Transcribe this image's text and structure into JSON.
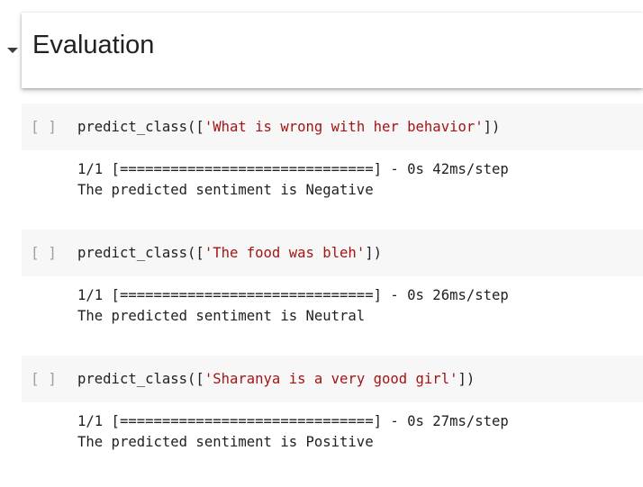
{
  "section": {
    "title": "Evaluation"
  },
  "cells": [
    {
      "run_label": "[ ]",
      "code_prefix": "predict_class([",
      "code_string": "'What is wrong with her behavior'",
      "code_suffix": "])",
      "progress_line": "1/1 [==============================] - 0s 42ms/step",
      "result_line": "The predicted sentiment is Negative"
    },
    {
      "run_label": "[ ]",
      "code_prefix": "predict_class([",
      "code_string": "'The food was bleh'",
      "code_suffix": "])",
      "progress_line": "1/1 [==============================] - 0s 26ms/step",
      "result_line": "The predicted sentiment is Neutral"
    },
    {
      "run_label": "[ ]",
      "code_prefix": "predict_class([",
      "code_string": "'Sharanya is a very good girl'",
      "code_suffix": "])",
      "progress_line": "1/1 [==============================] - 0s 27ms/step",
      "result_line": "The predicted sentiment is Positive"
    }
  ],
  "colors": {
    "string_literal": "#a31515",
    "code_bg": "#f7f7f7",
    "run_bracket": "#9aa0a6"
  },
  "icons": {
    "collapse": "triangle-down-icon"
  }
}
